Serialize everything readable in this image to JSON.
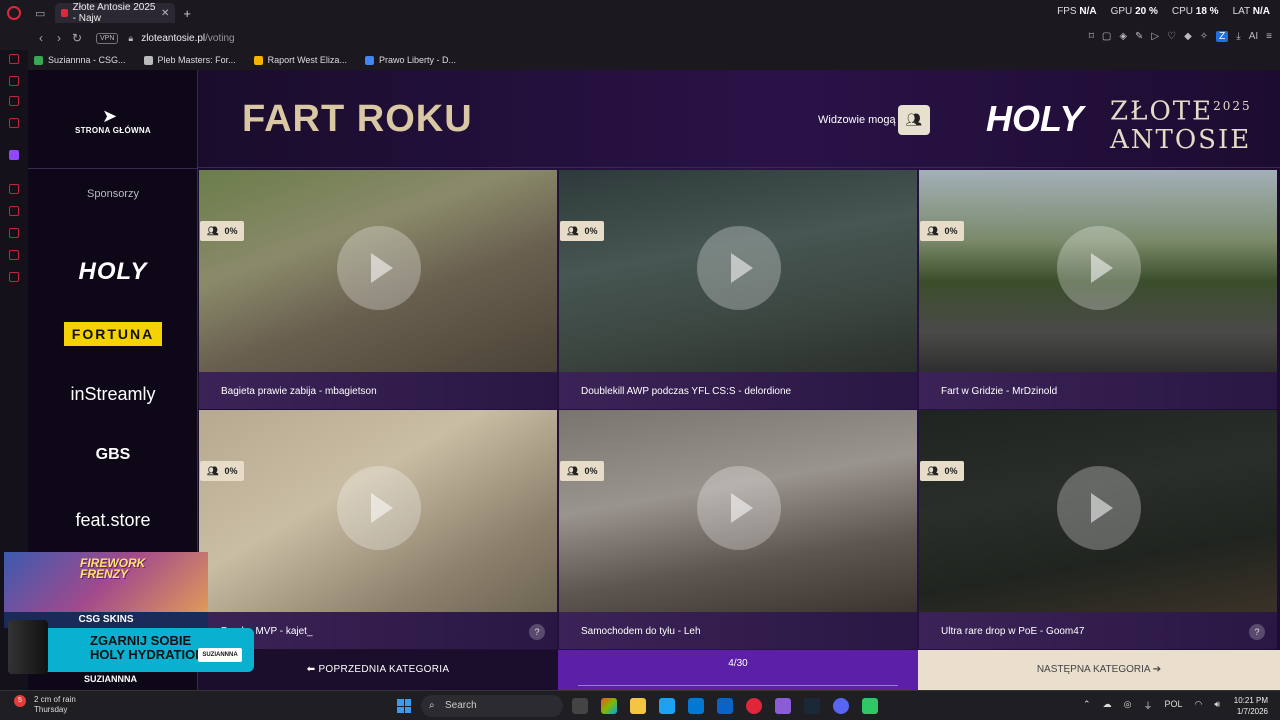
{
  "browser": {
    "tab_title": "Złote Antosie 2025 - Najw",
    "url_domain": "zloteantosie.pl",
    "url_path": "/voting",
    "vpn_label": "VPN",
    "stats": [
      {
        "label": "FPS",
        "value": "N/A"
      },
      {
        "label": "GPU",
        "value": "20 %"
      },
      {
        "label": "CPU",
        "value": "18 %"
      },
      {
        "label": "LAT",
        "value": "N/A"
      }
    ],
    "ai_label": "AI",
    "bookmarks": [
      {
        "label": "Suziannna - CSG...",
        "color": "#3aa757"
      },
      {
        "label": "Pleb Masters: For...",
        "color": "#bbbbbb"
      },
      {
        "label": "Raport West Eliza...",
        "color": "#f4b400"
      },
      {
        "label": "Prawo Liberty - D...",
        "color": "#4285f4"
      }
    ]
  },
  "sidebar": {
    "home_label": "STRONA GŁÓWNA",
    "sponsors_label": "Sponsorzy",
    "sponsors": [
      "HOLY",
      "FORTUNA",
      "inStreamly",
      "GBS",
      "feat.store"
    ]
  },
  "header": {
    "title": "FART ROKU",
    "viewers_label": "Widzowie mogą",
    "brand_holy": "HOLY",
    "brand_zlote": "ZŁOTE",
    "brand_year": "2025",
    "brand_antosie": "ANTOSIE"
  },
  "cards": [
    {
      "percent": "0%",
      "caption": "Bagieta prawie zabija - mbagietson"
    },
    {
      "percent": "0%",
      "caption": "Doublekill AWP podczas YFL CS:S - delordione"
    },
    {
      "percent": "0%",
      "caption": "Fart w Gridzie - MrDzinold"
    },
    {
      "percent": "0%",
      "caption": "Bomba MVP - kajet_"
    },
    {
      "percent": "0%",
      "caption": "Samochodem do tyłu - Leh"
    },
    {
      "percent": "0%",
      "caption": "Ultra rare drop w PoE - Goom47"
    }
  ],
  "nav": {
    "prev_label": "POPRZEDNIA KATEGORIA",
    "page_indicator": "4/30",
    "next_label": "NASTĘPNA KATEGORIA"
  },
  "ad": {
    "title_line1": "FIREWORK",
    "title_line2": "FRENZY",
    "brand": "CSG SKINS",
    "banner_line1": "ZGARNIJ SOBIE",
    "banner_line2": "HOLY HYDRATION",
    "signature": "SUZIANNNA",
    "streamer": "SUZIANNNA"
  },
  "taskbar": {
    "weather_text": "2 cm of rain",
    "weather_day": "Thursday",
    "notification_count": "5",
    "search_placeholder": "Search",
    "language": "POL",
    "time": "10:21 PM",
    "date": "1/7/2026"
  }
}
